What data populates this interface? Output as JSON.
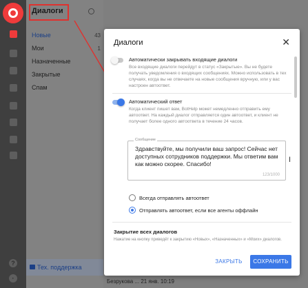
{
  "panel": {
    "title": "Диалоги",
    "items": [
      {
        "label": "Новые",
        "count": "43"
      },
      {
        "label": "Мои",
        "count": "1"
      },
      {
        "label": "Назначенные",
        "count": ""
      },
      {
        "label": "Закрытые",
        "count": ""
      },
      {
        "label": "Спам",
        "count": ""
      }
    ],
    "support": "Тех. поддержка"
  },
  "background": {
    "row_text": "Безрукова ...      21 янв. 10:19"
  },
  "modal": {
    "title": "Диалоги",
    "close_glyph": "✕",
    "auto_close": {
      "label": "Автоматически закрывать входящие диалоги",
      "enabled": false,
      "description": "Все входящие диалоги перейдут в статус «Закрытые». Вы не будете получать уведомления о входящих сообщениях. Можно использовать в тех случаях, когда вы не отвечаете на новые сообщения вручную, или у вас настроен автоответ."
    },
    "auto_reply": {
      "label": "Автоматический ответ",
      "enabled": true,
      "description": "Когда клиент пишет вам, BotHelp может немедленно отправить ему автоответ. На каждый диалог отправляется один автоответ, и клиент не получает более одного автоответа в течение 24 часов."
    },
    "message": {
      "legend": "Сообщение",
      "text": "Здравствуйте, мы получили ваш запрос! Сейчас нет доступных сотрудников поддержки. Мы ответим вам как можно скорее. Спасибо!",
      "counter": "123/1000"
    },
    "radio_options": [
      {
        "label": "Всегда отправлять автоответ",
        "selected": false
      },
      {
        "label": "Отправлять автоответ, если все агенты оффлайн",
        "selected": true
      }
    ],
    "close_all": {
      "title": "Закрытие всех диалогов",
      "description": "Нажатие на кнопку приведёт к закрытию «Новых», «Назначенных» и «Моих» диалогов."
    },
    "cancel_label": "ЗАКРЫТЬ",
    "save_label": "СОХРАНИТЬ"
  },
  "colors": {
    "accent": "#3b78e7",
    "brand": "#ef3b3b",
    "annotation": "#e0312e"
  },
  "icons": [
    "logo-icon",
    "dialogs-icon",
    "users-icon",
    "send-icon",
    "bot-icon",
    "settings-icon",
    "stats-icon",
    "plug-icon",
    "chart-icon",
    "help-icon",
    "search-icon",
    "close-icon",
    "support-icon"
  ]
}
